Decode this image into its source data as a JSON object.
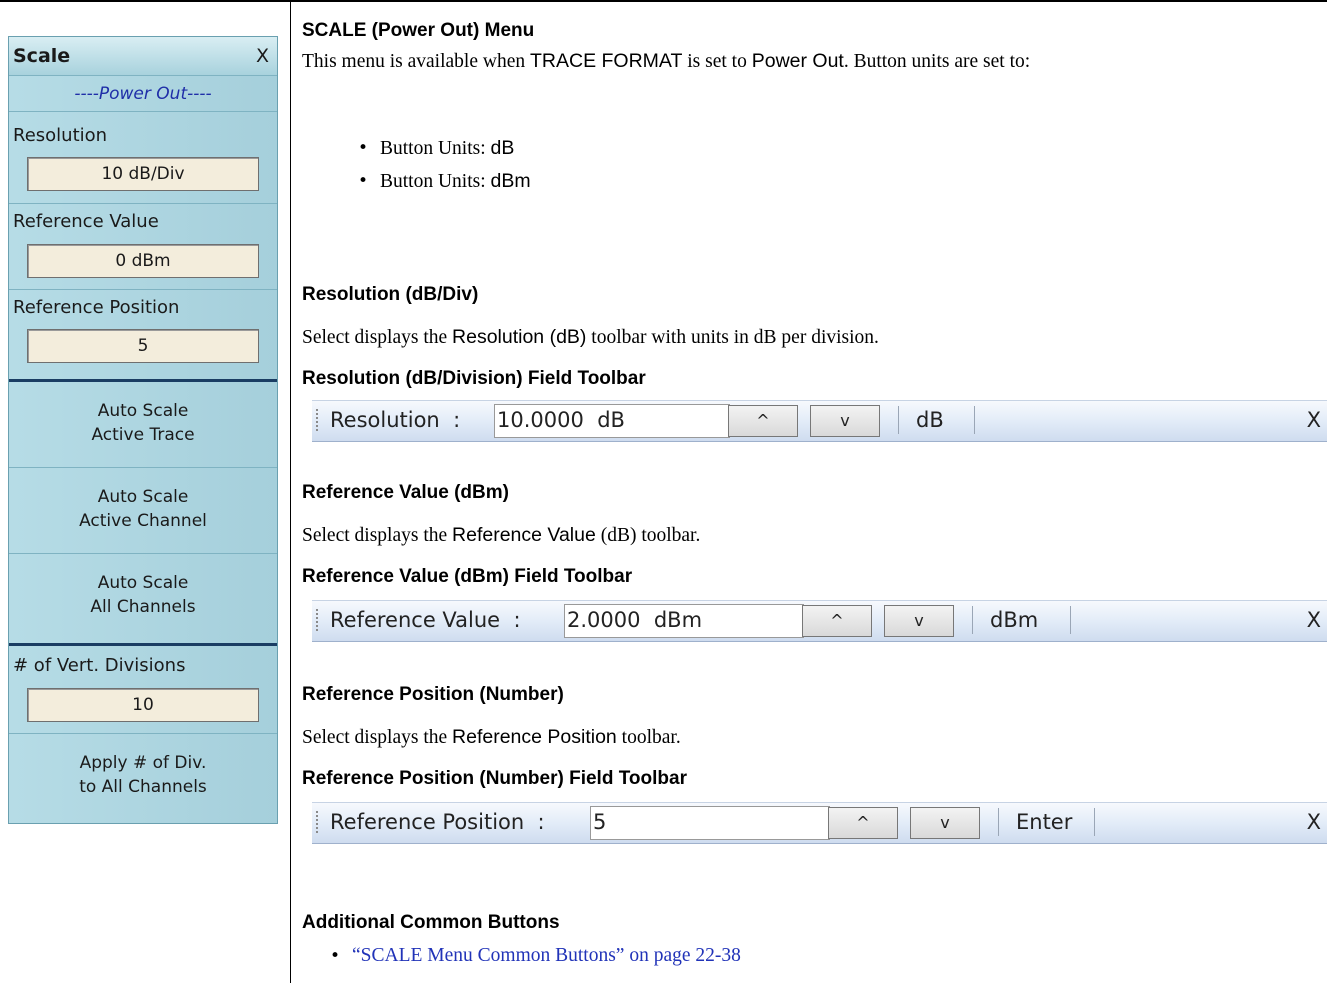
{
  "menu": {
    "title": "Scale",
    "close": "X",
    "subtitle": "----Power Out----",
    "fields": [
      {
        "label": "Resolution",
        "value": "10  dB/Div"
      },
      {
        "label": "Reference Value",
        "value": "0  dBm"
      },
      {
        "label": "Reference Position",
        "value": "5"
      }
    ],
    "buttons": [
      {
        "line1": "Auto Scale",
        "line2": "Active Trace"
      },
      {
        "line1": "Auto Scale",
        "line2": "Active Channel"
      },
      {
        "line1": "Auto Scale",
        "line2": "All Channels"
      }
    ],
    "divisions": {
      "label": "# of Vert. Divisions",
      "value": "10"
    },
    "apply": {
      "line1": "Apply # of Div.",
      "line2": "to All Channels"
    }
  },
  "doc": {
    "heading": "SCALE (Power Out) Menu",
    "intro": {
      "p1": "This menu is available when ",
      "s1": "TRACE FORMAT",
      "p2": " is set to ",
      "s2": "Power Out",
      "p3": ". Button units are set to:"
    },
    "units": [
      {
        "text": "Button Units: ",
        "value": "dB"
      },
      {
        "text": "Button Units: ",
        "value": "dBm"
      }
    ],
    "resolution": {
      "heading": "Resolution (dB/Div)",
      "desc_a": "Select displays the ",
      "desc_b": "Resolution (dB)",
      "desc_c": " toolbar with units in dB per division.",
      "toolbar_heading": "Resolution (dB/Division) Field Toolbar",
      "toolbar": {
        "label": "Resolution  :",
        "value": "10.0000  dB",
        "unit": "dB",
        "close": "X"
      }
    },
    "refvalue": {
      "heading": "Reference Value (dBm)",
      "desc_a": "Select displays the ",
      "desc_b": "Reference Value",
      "desc_c": " (dB) toolbar.",
      "toolbar_heading": "Reference Value (dBm) Field Toolbar",
      "toolbar": {
        "label": "Reference Value  :",
        "value": "2.0000  dBm",
        "unit": "dBm",
        "close": "X"
      }
    },
    "refpos": {
      "heading": "Reference Position (Number)",
      "desc_a": "Select displays the ",
      "desc_b": "Reference Position",
      "desc_c": " toolbar.",
      "toolbar_heading": "Reference Position (Number) Field Toolbar",
      "toolbar": {
        "label": "Reference Position  :",
        "value": "5",
        "unit": "Enter",
        "close": "X"
      }
    },
    "additional": {
      "heading": "Additional Common Buttons",
      "link": "“SCALE Menu Common Buttons” on page 22-38"
    },
    "arrows": {
      "up": "^",
      "down": "v"
    }
  }
}
